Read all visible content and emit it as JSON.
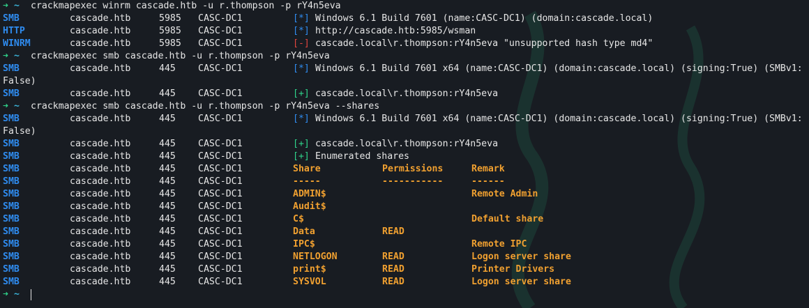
{
  "prompt": {
    "arrow": "➜",
    "tilde": "~"
  },
  "commands": [
    "crackmapexec winrm cascade.htb -u r.thompson -p rY4n5eva",
    "crackmapexec smb cascade.htb -u r.thompson -p rY4n5eva",
    "crackmapexec smb cascade.htb -u r.thompson -p rY4n5eva --shares"
  ],
  "winrm_block": [
    {
      "proto": "SMB",
      "host": "cascade.htb",
      "port": "5985",
      "name": "CASC-DC1",
      "mark": "[*]",
      "msg": "Windows 6.1 Build 7601 (name:CASC-DC1) (domain:cascade.local)"
    },
    {
      "proto": "HTTP",
      "host": "cascade.htb",
      "port": "5985",
      "name": "CASC-DC1",
      "mark": "[*]",
      "msg": "http://cascade.htb:5985/wsman"
    },
    {
      "proto": "WINRM",
      "host": "cascade.htb",
      "port": "5985",
      "name": "CASC-DC1",
      "mark": "[-]",
      "msg": "cascade.local\\r.thompson:rY4n5eva \"unsupported hash type md4\""
    }
  ],
  "smb_block": {
    "info": {
      "proto": "SMB",
      "host": "cascade.htb",
      "port": "445",
      "name": "CASC-DC1",
      "mark": "[*]",
      "msg": "Windows 6.1 Build 7601 x64 (name:CASC-DC1) (domain:cascade.local) (signing:True) (SMBv1:",
      "wrap": "False)"
    },
    "auth": {
      "proto": "SMB",
      "host": "cascade.htb",
      "port": "445",
      "name": "CASC-DC1",
      "mark": "[+]",
      "msg": "cascade.local\\r.thompson:rY4n5eva"
    }
  },
  "shares_block": {
    "info": {
      "proto": "SMB",
      "host": "cascade.htb",
      "port": "445",
      "name": "CASC-DC1",
      "mark": "[*]",
      "msg": "Windows 6.1 Build 7601 x64 (name:CASC-DC1) (domain:cascade.local) (signing:True) (SMBv1:",
      "wrap": "False)"
    },
    "auth": {
      "proto": "SMB",
      "host": "cascade.htb",
      "port": "445",
      "name": "CASC-DC1",
      "mark": "[+]",
      "msg": "cascade.local\\r.thompson:rY4n5eva"
    },
    "enum": {
      "proto": "SMB",
      "host": "cascade.htb",
      "port": "445",
      "name": "CASC-DC1",
      "mark": "[+]",
      "msg": "Enumerated shares"
    },
    "row_prefix": {
      "proto": "SMB",
      "host": "cascade.htb",
      "port": "445",
      "name": "CASC-DC1"
    },
    "headers": [
      "Share",
      "Permissions",
      "Remark"
    ],
    "separators": [
      "-----",
      "-----------",
      "------"
    ],
    "rows": [
      {
        "share": "ADMIN$",
        "perm": "",
        "remark": "Remote Admin"
      },
      {
        "share": "Audit$",
        "perm": "",
        "remark": ""
      },
      {
        "share": "C$",
        "perm": "",
        "remark": "Default share"
      },
      {
        "share": "Data",
        "perm": "READ",
        "remark": ""
      },
      {
        "share": "IPC$",
        "perm": "",
        "remark": "Remote IPC"
      },
      {
        "share": "NETLOGON",
        "perm": "READ",
        "remark": "Logon server share"
      },
      {
        "share": "print$",
        "perm": "READ",
        "remark": "Printer Drivers"
      },
      {
        "share": "SYSVOL",
        "perm": "READ",
        "remark": "Logon server share"
      }
    ]
  },
  "colors": {
    "background": "#181c22",
    "proto": "#2f8cf0",
    "success": "#2fd38a",
    "error": "#e0453f",
    "share": "#f0a030"
  }
}
